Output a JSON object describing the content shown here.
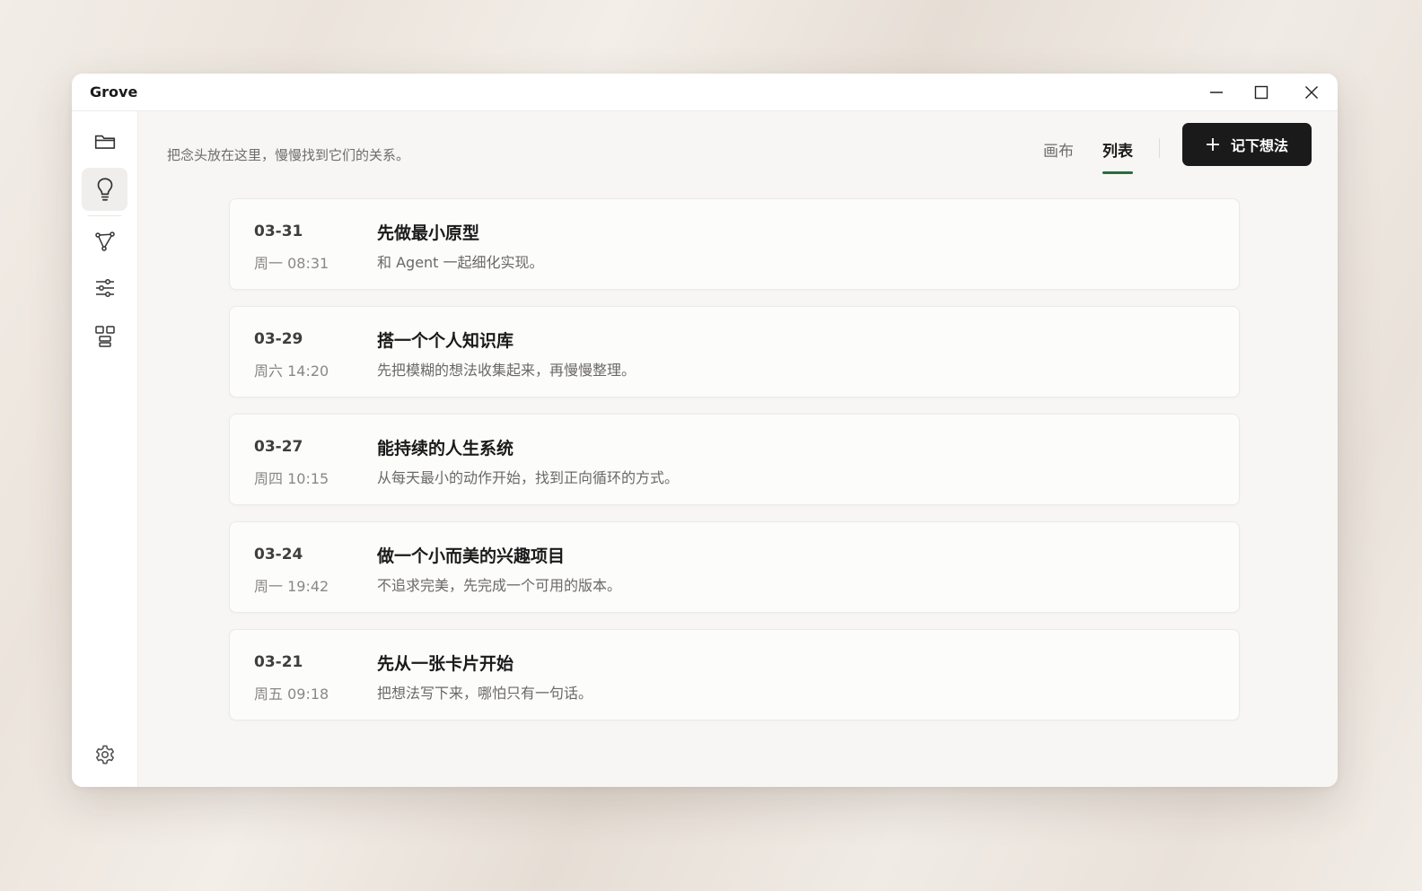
{
  "window": {
    "title": "Grove"
  },
  "sidebar": {
    "items": [
      {
        "name": "folder-icon"
      },
      {
        "name": "lightbulb-icon",
        "active": true
      },
      {
        "name": "graph-icon"
      },
      {
        "name": "sliders-icon"
      },
      {
        "name": "layout-icon"
      }
    ],
    "footer": {
      "name": "settings-icon"
    }
  },
  "header": {
    "subtitle": "把念头放在这里，慢慢找到它们的关系。",
    "tabs": [
      {
        "label": "画布",
        "active": false
      },
      {
        "label": "列表",
        "active": true
      }
    ],
    "new_button_label": "记下想法"
  },
  "ideas": [
    {
      "date": "03-31",
      "time": "周一 08:31",
      "title": "先做最小原型",
      "desc": "和 Agent 一起细化实现。"
    },
    {
      "date": "03-29",
      "time": "周六 14:20",
      "title": "搭一个个人知识库",
      "desc": "先把模糊的想法收集起来，再慢慢整理。"
    },
    {
      "date": "03-27",
      "time": "周四 10:15",
      "title": "能持续的人生系统",
      "desc": "从每天最小的动作开始，找到正向循环的方式。"
    },
    {
      "date": "03-24",
      "time": "周一 19:42",
      "title": "做一个小而美的兴趣项目",
      "desc": "不追求完美，先完成一个可用的版本。"
    },
    {
      "date": "03-21",
      "time": "周五 09:18",
      "title": "先从一张卡片开始",
      "desc": "把想法写下来，哪怕只有一句话。"
    }
  ],
  "colors": {
    "accent": "#2e6b3c",
    "button_bg": "#1a1a1a",
    "active_nav_bg": "#efeeec"
  }
}
